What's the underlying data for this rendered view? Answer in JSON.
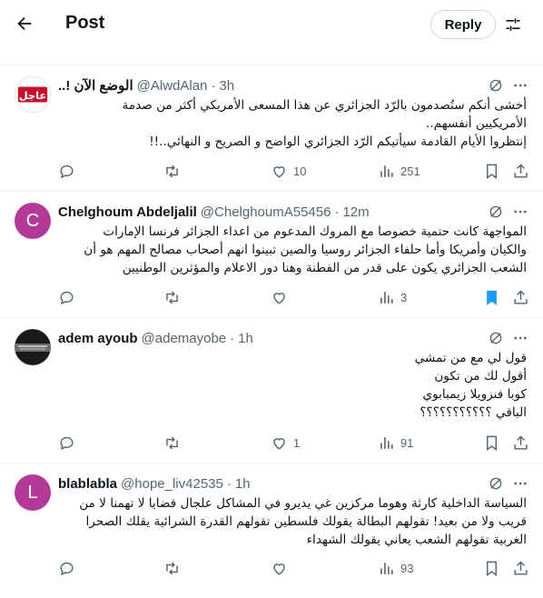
{
  "header": {
    "title": "Post",
    "reply_label": "Reply"
  },
  "tweets": [
    {
      "name": "الوضع الآن !..",
      "handle": "@AlwdAlan",
      "time": "3h",
      "avatar_text": "عاجل",
      "lines": [
        "أخشى أنكم ستُصدمون بالرّد الجزائري عن هذا المسعى الأمريكي أكثر من صدمة",
        "الأمريكيين أنفسهم..",
        "إنتظروا الأيام القادمة سيأتيكم الرّد الجزائري الواضح و الصريح و النهائي..!!"
      ],
      "likes": "10",
      "views": "251",
      "bookmarked": false
    },
    {
      "name": "Chelghoum Abdeljalil",
      "handle": "@ChelghoumA55456",
      "time": "12m",
      "avatar_text": "C",
      "lines": [
        "المواجهة كانت حتمية خصوصا مع المروك المدعوم من اعداء الجزائر فرنسا الإمارات",
        "والكيان وأمريكا وأما حلفاء الجزائر روسيا والصين تبينوا انهم أصحاب مصالح المهم هو أن",
        "الشعب الجزائري يكون على قدر من الفطنة وهنا دور الاعلام والمؤثرين الوطنيين"
      ],
      "likes": "",
      "views": "3",
      "bookmarked": true
    },
    {
      "name": "adem ayoub",
      "handle": "@ademayobe",
      "time": "1h",
      "avatar_text": "",
      "lines": [
        "قول لي مع من تمشي",
        "أقول لك من تكون",
        "كوبا فنزويلا زيمبابوي",
        "الباقي ؟؟؟؟؟؟؟؟؟؟؟"
      ],
      "likes": "1",
      "views": "91",
      "bookmarked": false
    },
    {
      "name": "blablabla",
      "handle": "@hope_liv42535",
      "time": "1h",
      "avatar_text": "L",
      "lines": [
        "السياسة الداخلية كارثة وهوما مركزين غي يديرو في المشاكل علجال قضايا لا تهمنا لا من",
        "قريب ولا من بعيد! تقولهم البطالة يقولك فلسطين تقولهم القدرة الشرائية يقلك الصحرا",
        "الغربية تقولهم الشعب يعاني يقولك الشهداء"
      ],
      "likes": "",
      "views": "93",
      "bookmarked": false
    }
  ],
  "colors": {
    "accent": "#1d9bf0",
    "muted": "#536471",
    "border": "#eff3f4",
    "urgent_red": "#c8102e",
    "avatar_purple": "#b43a9a"
  },
  "icons": [
    "back-arrow-icon",
    "sliders-icon",
    "grok-icon",
    "more-icon",
    "reply-icon",
    "repost-icon",
    "like-icon",
    "views-icon",
    "bookmark-icon",
    "share-icon"
  ]
}
